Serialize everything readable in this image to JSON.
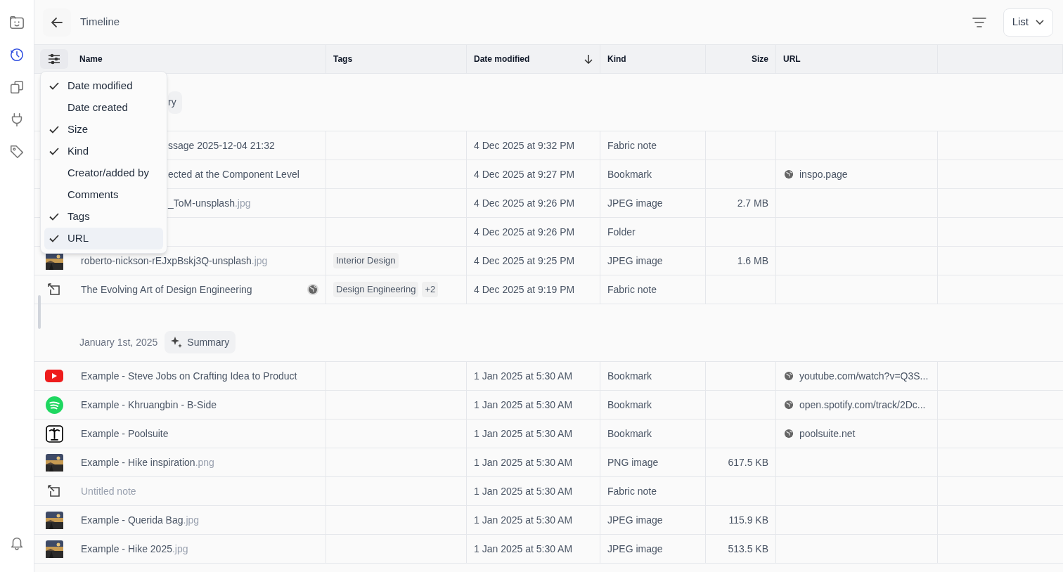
{
  "sidebar": {
    "items": [
      {
        "kind": "face",
        "selected": false
      },
      {
        "kind": "clock",
        "selected": true
      },
      {
        "kind": "copy",
        "selected": false
      },
      {
        "kind": "plug",
        "selected": false
      },
      {
        "kind": "tag",
        "selected": false
      }
    ],
    "bottom": [
      {
        "kind": "bell",
        "selected": false
      }
    ]
  },
  "header": {
    "title": "Timeline",
    "view": "List"
  },
  "table": {
    "columns": [
      {
        "label": "Name",
        "sorted": false
      },
      {
        "label": "Tags",
        "sorted": false
      },
      {
        "label": "Date modified",
        "sorted": true
      },
      {
        "label": "Kind",
        "sorted": false
      },
      {
        "label": "Size",
        "sorted": false
      },
      {
        "label": "URL",
        "sorted": false
      }
    ],
    "groups": [
      {
        "summary": "ry",
        "rows": [
          {
            "kind": "none",
            "covered": true,
            "name": "ssage 2025-12-04 21:32",
            "date": "4 Dec 2025 at 9:32 PM",
            "file_kind": "Fabric note"
          },
          {
            "kind": "none",
            "covered": true,
            "name": "ected at the Component Level",
            "date": "4 Dec 2025 at 9:27 PM",
            "file_kind": "Bookmark",
            "url": "inspo.page"
          },
          {
            "kind": "none",
            "covered": true,
            "name": "_ToM-unsplash",
            "ext": ".jpg",
            "date": "4 Dec 2025 at 9:26 PM",
            "file_kind": "JPEG image",
            "size": "2.7 MB"
          },
          {
            "kind": "none",
            "date": "4 Dec 2025 at 9:26 PM",
            "file_kind": "Folder"
          },
          {
            "kind": "picture",
            "covered": false,
            "name": "roberto-nickson-rEJxpBskj3Q-unsplash",
            "ext": ".jpg",
            "tags": [
              "Interior Design"
            ],
            "date": "4 Dec 2025 at 9:25 PM",
            "file_kind": "JPEG image",
            "size": "1.6 MB"
          },
          {
            "kind": "note",
            "covered": false,
            "shared": true,
            "name": "The Evolving Art of Design Engineering",
            "tags": [
              "Design Engineering",
              "+2"
            ],
            "date": "4 Dec 2025 at 9:19 PM",
            "file_kind": "Fabric note"
          }
        ]
      },
      {
        "date": "January 1st, 2025",
        "summary": "Summary",
        "rows": [
          {
            "kind": "youtube",
            "covered": false,
            "name": "Example - Steve Jobs on Crafting Idea to Product",
            "date": "1 Jan 2025 at 5:30 AM",
            "file_kind": "Bookmark",
            "url": "youtube.com/watch?v=Q3S..."
          },
          {
            "kind": "spotify",
            "covered": false,
            "name": "Example - Khruangbin - B-Side",
            "date": "1 Jan 2025 at 5:30 AM",
            "file_kind": "Bookmark",
            "url": "open.spotify.com/track/2Dc..."
          },
          {
            "kind": "palm",
            "covered": false,
            "name": "Example - Poolsuite",
            "date": "1 Jan 2025 at 5:30 AM",
            "file_kind": "Bookmark",
            "url": "poolsuite.net"
          },
          {
            "kind": "picture",
            "covered": false,
            "name": "Example - Hike inspiration",
            "ext": ".png",
            "date": "1 Jan 2025 at 5:30 AM",
            "file_kind": "PNG image",
            "size": "617.5 KB"
          },
          {
            "kind": "note",
            "covered": false,
            "placeholder": true,
            "name": "Untitled note",
            "date": "1 Jan 2025 at 5:30 AM",
            "file_kind": "Fabric note"
          },
          {
            "kind": "picture",
            "covered": false,
            "name": "Example - Querida Bag",
            "ext": ".jpg",
            "date": "1 Jan 2025 at 5:30 AM",
            "file_kind": "JPEG image",
            "size": "115.9 KB"
          },
          {
            "kind": "picture",
            "covered": false,
            "name": "Example - Hike 2025",
            "ext": ".jpg",
            "date": "1 Jan 2025 at 5:30 AM",
            "file_kind": "JPEG image",
            "size": "513.5 KB"
          }
        ]
      }
    ]
  },
  "column_menu": {
    "items": [
      {
        "label": "Date modified",
        "checked": true,
        "selected": false
      },
      {
        "label": "Date created",
        "checked": false,
        "selected": false
      },
      {
        "label": "Size",
        "checked": true,
        "selected": false
      },
      {
        "label": "Kind",
        "checked": true,
        "selected": false
      },
      {
        "label": "Creator/added by",
        "checked": false,
        "selected": false
      },
      {
        "label": "Comments",
        "checked": false,
        "selected": false
      },
      {
        "label": "Tags",
        "checked": true,
        "selected": false
      },
      {
        "label": "URL",
        "checked": true,
        "selected": true
      }
    ]
  }
}
